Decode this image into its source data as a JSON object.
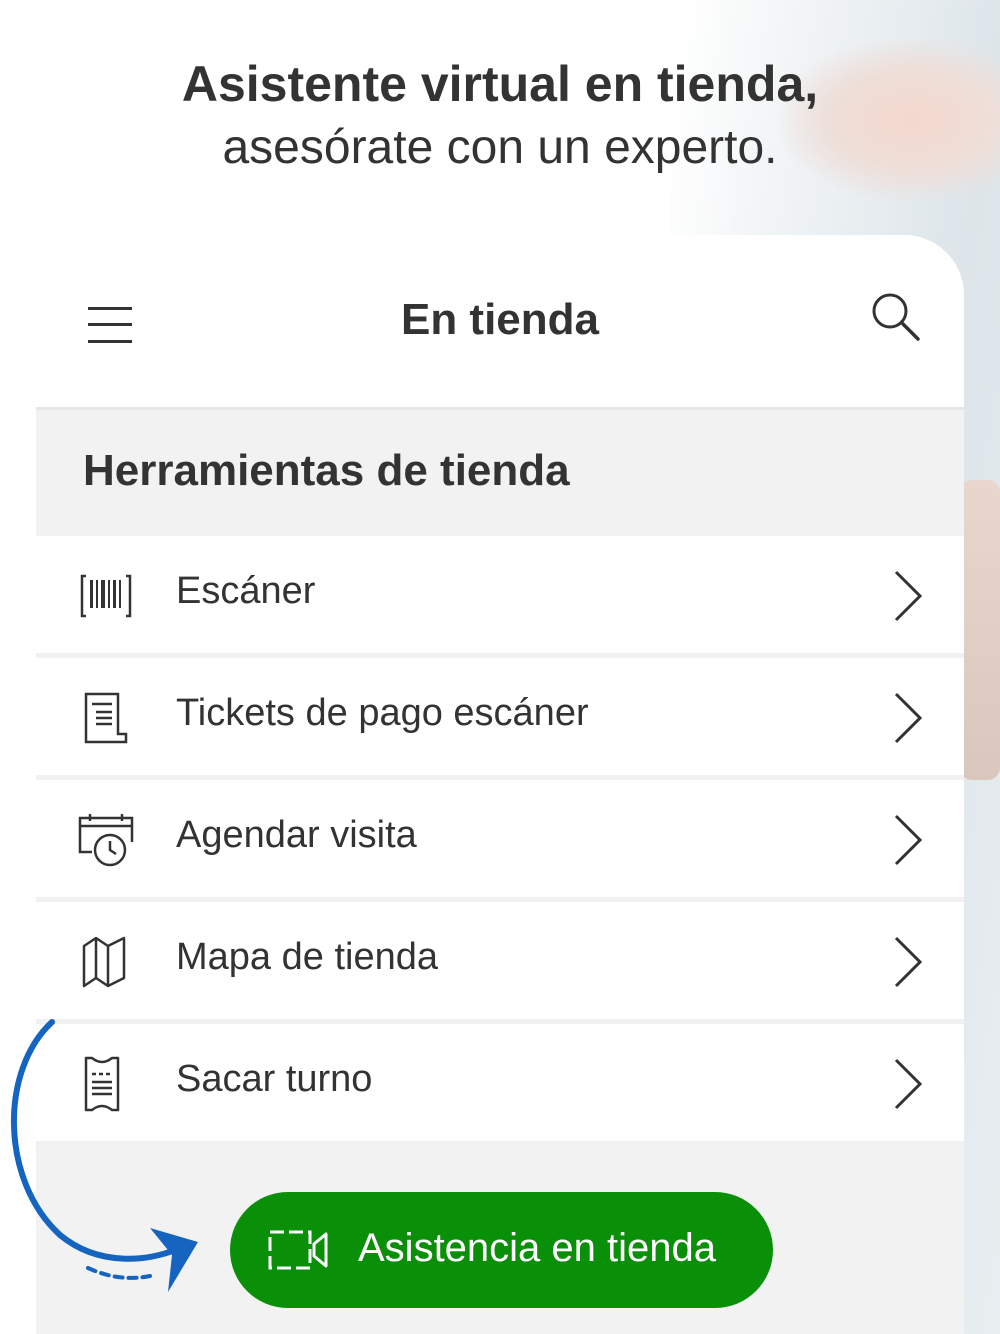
{
  "promo": {
    "headline": "Asistente virtual en tienda,",
    "subheadline": "asesórate con un experto."
  },
  "appbar": {
    "title": "En tienda",
    "menu_icon": "hamburger-menu-icon",
    "search_icon": "search-icon"
  },
  "section": {
    "title": "Herramientas de tienda"
  },
  "menu_items": [
    {
      "label": "Escáner",
      "icon": "barcode-icon"
    },
    {
      "label": "Tickets de pago escáner",
      "icon": "receipt-icon"
    },
    {
      "label": "Agendar visita",
      "icon": "calendar-clock-icon"
    },
    {
      "label": "Mapa de tienda",
      "icon": "map-icon"
    },
    {
      "label": "Sacar turno",
      "icon": "ticket-icon"
    }
  ],
  "cta": {
    "label": "Asistencia en tienda",
    "icon": "video-camera-icon"
  },
  "colors": {
    "accent_green": "#0a8f08",
    "arrow_blue": "#1565c0",
    "text": "#333333",
    "section_bg": "#f2f2f2"
  }
}
